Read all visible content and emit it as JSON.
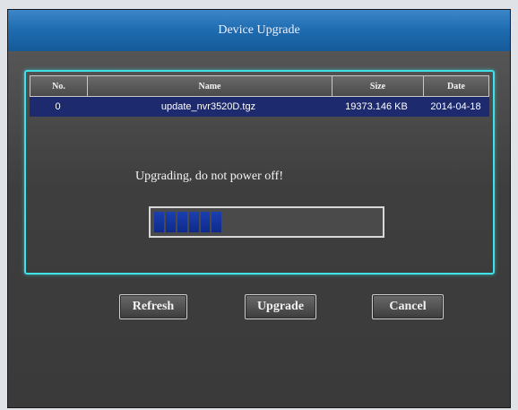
{
  "dialog": {
    "title": "Device Upgrade"
  },
  "table": {
    "headers": {
      "no": "No.",
      "name": "Name",
      "size": "Size",
      "date": "Date"
    },
    "rows": [
      {
        "no": "0",
        "name": "update_nvr3520D.tgz",
        "size": "19373.146 KB",
        "date": "2014-04-18"
      }
    ]
  },
  "status": {
    "message": "Upgrading, do not power off!"
  },
  "progress": {
    "value_fraction": 0.3
  },
  "buttons": {
    "refresh_label": "Refresh",
    "upgrade_label": "Upgrade",
    "cancel_label": "Cancel"
  },
  "colors": {
    "title_bar": "#1f6bb0",
    "frame_border": "#3fe0e6",
    "selected_row": "#1d2a6e",
    "progress_fill": "#0e2a8a"
  }
}
